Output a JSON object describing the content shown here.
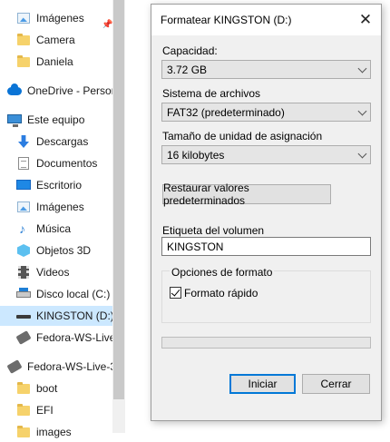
{
  "nav": {
    "items": [
      {
        "label": "Imágenes",
        "icon": "pictures-icon"
      },
      {
        "label": "Camera",
        "icon": "folder-icon"
      },
      {
        "label": "Daniela",
        "icon": "folder-icon"
      },
      {
        "label": "OneDrive - Persor",
        "icon": "onedrive-cloud-icon"
      },
      {
        "label": "Este equipo",
        "icon": "computer-icon"
      },
      {
        "label": "Descargas",
        "icon": "downloads-icon"
      },
      {
        "label": "Documentos",
        "icon": "documents-icon"
      },
      {
        "label": "Escritorio",
        "icon": "desktop-icon"
      },
      {
        "label": "Imágenes",
        "icon": "pictures-icon"
      },
      {
        "label": "Música",
        "icon": "music-icon"
      },
      {
        "label": "Objetos 3D",
        "icon": "3d-objects-icon"
      },
      {
        "label": "Videos",
        "icon": "videos-icon"
      },
      {
        "label": "Disco local (C:)",
        "icon": "local-disk-icon"
      },
      {
        "label": "KINGSTON (D:)",
        "icon": "usb-drive-icon"
      },
      {
        "label": "Fedora-WS-Live-",
        "icon": "usb-drive-icon"
      },
      {
        "label": "Fedora-WS-Live-3",
        "icon": "usb-drive-icon"
      },
      {
        "label": "boot",
        "icon": "folder-icon"
      },
      {
        "label": "EFI",
        "icon": "folder-icon"
      },
      {
        "label": "images",
        "icon": "folder-icon"
      }
    ],
    "selected_label": "KINGSTON (D:)"
  },
  "dialog": {
    "title": "Formatear KINGSTON (D:)",
    "capacity_label": "Capacidad:",
    "capacity_value": "3.72 GB",
    "filesystem_label": "Sistema de archivos",
    "filesystem_value": "FAT32 (predeterminado)",
    "allocation_label": "Tamaño de unidad de asignación",
    "allocation_value": "16 kilobytes",
    "restore_button": "Restaurar valores predeterminados",
    "volume_label": "Etiqueta del volumen",
    "volume_value": "KINGSTON",
    "options_title": "Opciones de formato",
    "quick_format_label": "Formato rápido",
    "quick_format_checked": true,
    "progress_fraction": 0,
    "start_button": "Iniciar",
    "close_button": "Cerrar"
  },
  "colors": {
    "selection": "#cce8ff",
    "dialog_bg": "#f0f0f0",
    "accent": "#0078d7"
  }
}
